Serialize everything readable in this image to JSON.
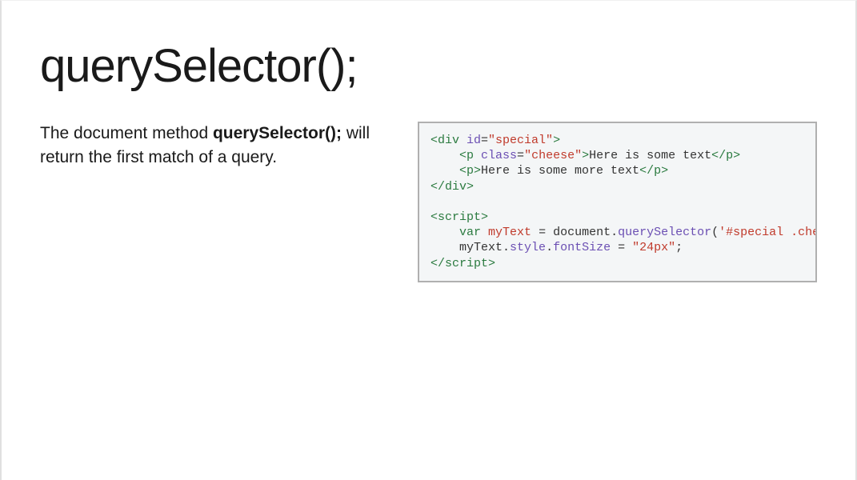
{
  "title": "querySelector();",
  "description": {
    "prefix": "The document method ",
    "bold": "querySelector();",
    "suffix": " will return the first match of a query."
  },
  "code": {
    "line1": {
      "open": "<div",
      "attr": " id",
      "eq": "=",
      "val": "\"special\"",
      "close": ">"
    },
    "line2": {
      "indent": "    ",
      "open": "<p",
      "attr": " class",
      "eq": "=",
      "val": "\"cheese\"",
      "mid": ">",
      "text": "Here is some text",
      "end": "</p>"
    },
    "line3": {
      "indent": "    ",
      "open": "<p>",
      "text": "Here is some more text",
      "end": "</p>"
    },
    "line4": {
      "text": "</div>"
    },
    "blank1": "",
    "line5": {
      "text": "<script>"
    },
    "line6": {
      "indent": "    ",
      "kw": "var",
      "sp1": " ",
      "var": "myText",
      "mid": " = document.",
      "func": "querySelector",
      "open": "(",
      "arg": "'#special .cheese'",
      "close": ");"
    },
    "line7": {
      "indent": "    ",
      "obj": "myText",
      "dot1": ".",
      "p1": "style",
      "dot2": ".",
      "p2": "fontSize",
      "mid": " = ",
      "val": "\"24px\"",
      "end": ";"
    },
    "line8": {
      "text": "</script>"
    }
  }
}
